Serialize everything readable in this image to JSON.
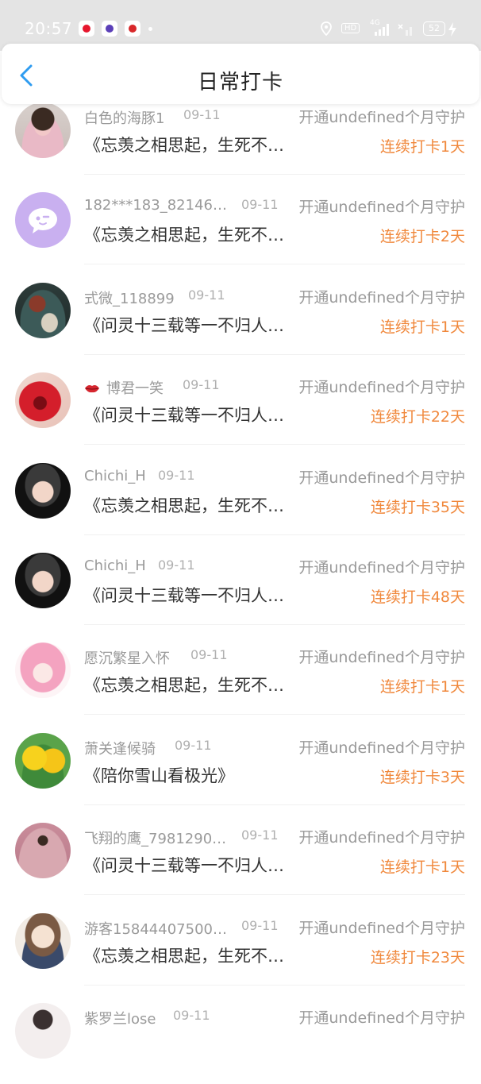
{
  "status_bar": {
    "time": "20:57",
    "hd": "HD",
    "network": "4G",
    "battery": "52"
  },
  "header": {
    "title": "日常打卡"
  },
  "entries": [
    {
      "name": "白色的海豚1",
      "date": "09-11",
      "guard": "开通undefined个月守护",
      "book": "《忘羡之相思起，生死不…",
      "streak": "连续打卡1天"
    },
    {
      "name": "182***183_82146…",
      "date": "09-11",
      "guard": "开通undefined个月守护",
      "book": "《忘羡之相思起，生死不…",
      "streak": "连续打卡2天"
    },
    {
      "name": "式微_118899",
      "date": "09-11",
      "guard": "开通undefined个月守护",
      "book": "《问灵十三载等一不归人…",
      "streak": "连续打卡1天"
    },
    {
      "name": "博君一笑",
      "date": "09-11",
      "guard": "开通undefined个月守护",
      "book": "《问灵十三载等一不归人…",
      "streak": "连续打卡22天"
    },
    {
      "name": "Chichi_H",
      "date": "09-11",
      "guard": "开通undefined个月守护",
      "book": "《忘羡之相思起，生死不…",
      "streak": "连续打卡35天"
    },
    {
      "name": "Chichi_H",
      "date": "09-11",
      "guard": "开通undefined个月守护",
      "book": "《问灵十三载等一不归人…",
      "streak": "连续打卡48天"
    },
    {
      "name": "愿沉繁星入怀",
      "date": "09-11",
      "guard": "开通undefined个月守护",
      "book": "《忘羡之相思起，生死不…",
      "streak": "连续打卡1天"
    },
    {
      "name": "萧关逢候骑",
      "date": "09-11",
      "guard": "开通undefined个月守护",
      "book": "《陪你雪山看极光》",
      "streak": "连续打卡3天"
    },
    {
      "name": "飞翔的鹰_7981290…",
      "date": "09-11",
      "guard": "开通undefined个月守护",
      "book": "《问灵十三载等一不归人…",
      "streak": "连续打卡1天"
    },
    {
      "name": "游客15844407500…",
      "date": "09-11",
      "guard": "开通undefined个月守护",
      "book": "《忘羡之相思起，生死不…",
      "streak": "连续打卡23天"
    },
    {
      "name": "紫罗兰lose",
      "date": "09-11",
      "guard": "开通undefined个月守护",
      "book": "",
      "streak": ""
    }
  ],
  "colors": {
    "accent_blue": "#2f9cf0",
    "streak_orange": "#f0883c",
    "meta_gray": "#9a9a9a"
  }
}
